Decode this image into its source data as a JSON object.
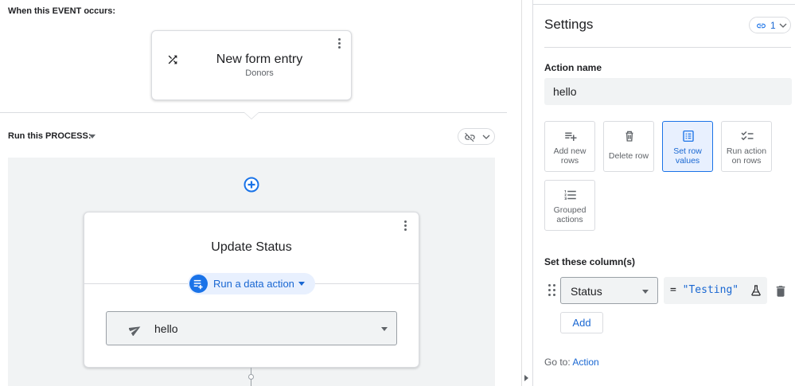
{
  "event_section": {
    "label": "When this EVENT occurs:",
    "card": {
      "title": "New form entry",
      "subtitle": "Donors"
    }
  },
  "process_section": {
    "label": "Run this PROCESS:",
    "step": {
      "title": "Update Status",
      "type_chip": "Run a data action",
      "action_value": "hello"
    }
  },
  "settings": {
    "title": "Settings",
    "link_count": "1",
    "action_name_label": "Action name",
    "action_name_value": "hello",
    "action_types": [
      {
        "label_line1": "Add new",
        "label_line2": "rows",
        "icon": "add-rows-icon",
        "selected": false
      },
      {
        "label_line1": "Delete row",
        "label_line2": "",
        "icon": "delete-row-icon",
        "selected": false
      },
      {
        "label_line1": "Set row",
        "label_line2": "values",
        "icon": "set-row-values-icon",
        "selected": true
      },
      {
        "label_line1": "Run action",
        "label_line2": "on rows",
        "icon": "run-action-icon",
        "selected": false
      },
      {
        "label_line1": "Grouped",
        "label_line2": "actions",
        "icon": "grouped-actions-icon",
        "selected": false
      }
    ],
    "set_columns_label": "Set these column(s)",
    "column_row": {
      "column": "Status",
      "expression_prefix": "= ",
      "expression_value": "\"Testing\""
    },
    "add_label": "Add",
    "goto_prefix": "Go to:",
    "goto_link": "Action"
  },
  "colors": {
    "accent": "#1a73e8",
    "accent_text": "#1967d2",
    "surface": "#f1f3f4",
    "border": "#dadce0"
  }
}
